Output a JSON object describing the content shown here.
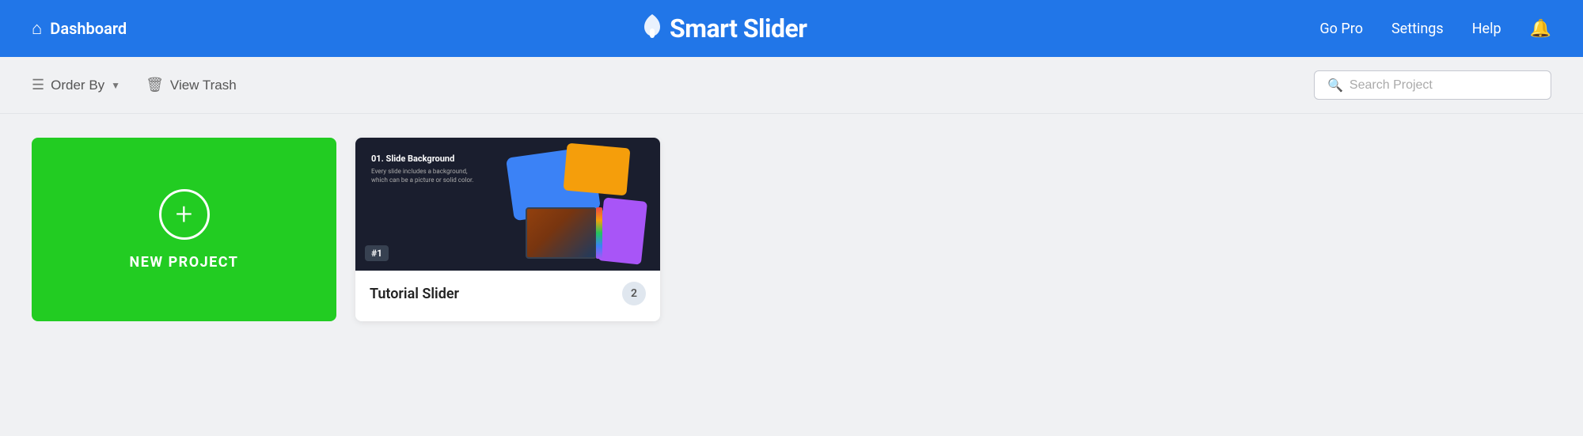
{
  "header": {
    "dashboard_label": "Dashboard",
    "logo_text": "Smart Slider",
    "go_pro_label": "Go Pro",
    "settings_label": "Settings",
    "help_label": "Help"
  },
  "toolbar": {
    "order_by_label": "Order By",
    "view_trash_label": "View Trash",
    "search_placeholder": "Search Project"
  },
  "new_project": {
    "label": "NEW PROJECT"
  },
  "sliders": [
    {
      "id": "#1",
      "name": "Tutorial Slider",
      "slide_count": "2"
    }
  ],
  "thumbnail": {
    "title": "01. Slide Background",
    "desc": "Every slide includes a background, which can be a picture or solid color."
  }
}
